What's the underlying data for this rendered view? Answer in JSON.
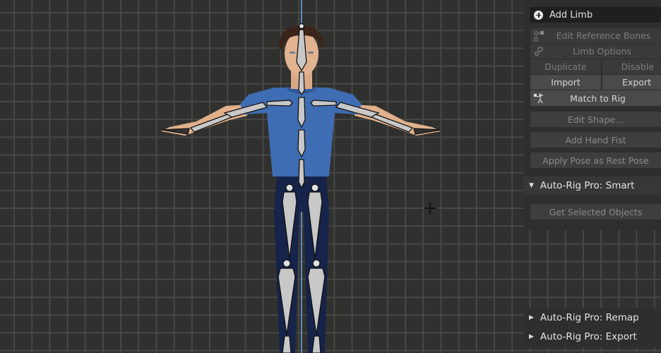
{
  "viewport": {
    "background_color": "#30312e",
    "grid_color": "#474845",
    "axis_color": "#5f86b8",
    "character": {
      "shirt_color": "#3f6db3",
      "pants_color": "#16234a",
      "skin_color": "#e2b38f",
      "hair_color": "#3b2419",
      "bone_color": "#c7c7c7"
    }
  },
  "panel": {
    "add_limb": "Add Limb",
    "edit_reference_bones": "Edit Reference Bones",
    "limb_options": "Limb Options",
    "duplicate": "Duplicate",
    "disable": "Disable",
    "import": "Import",
    "export": "Export",
    "match_to_rig": "Match to Rig",
    "edit_shape": "Edit Shape...",
    "add_hand_fist": "Add Hand Fist",
    "apply_pose_as_rest_pose": "Apply Pose as Rest Pose",
    "smart_section": {
      "title": "Auto-Rig Pro: Smart",
      "expanded": true,
      "get_selected_objects": "Get Selected Objects"
    },
    "remap_section": {
      "title": "Auto-Rig Pro: Remap",
      "expanded": false
    },
    "export_section": {
      "title": "Auto-Rig Pro: Export",
      "expanded": false
    }
  }
}
